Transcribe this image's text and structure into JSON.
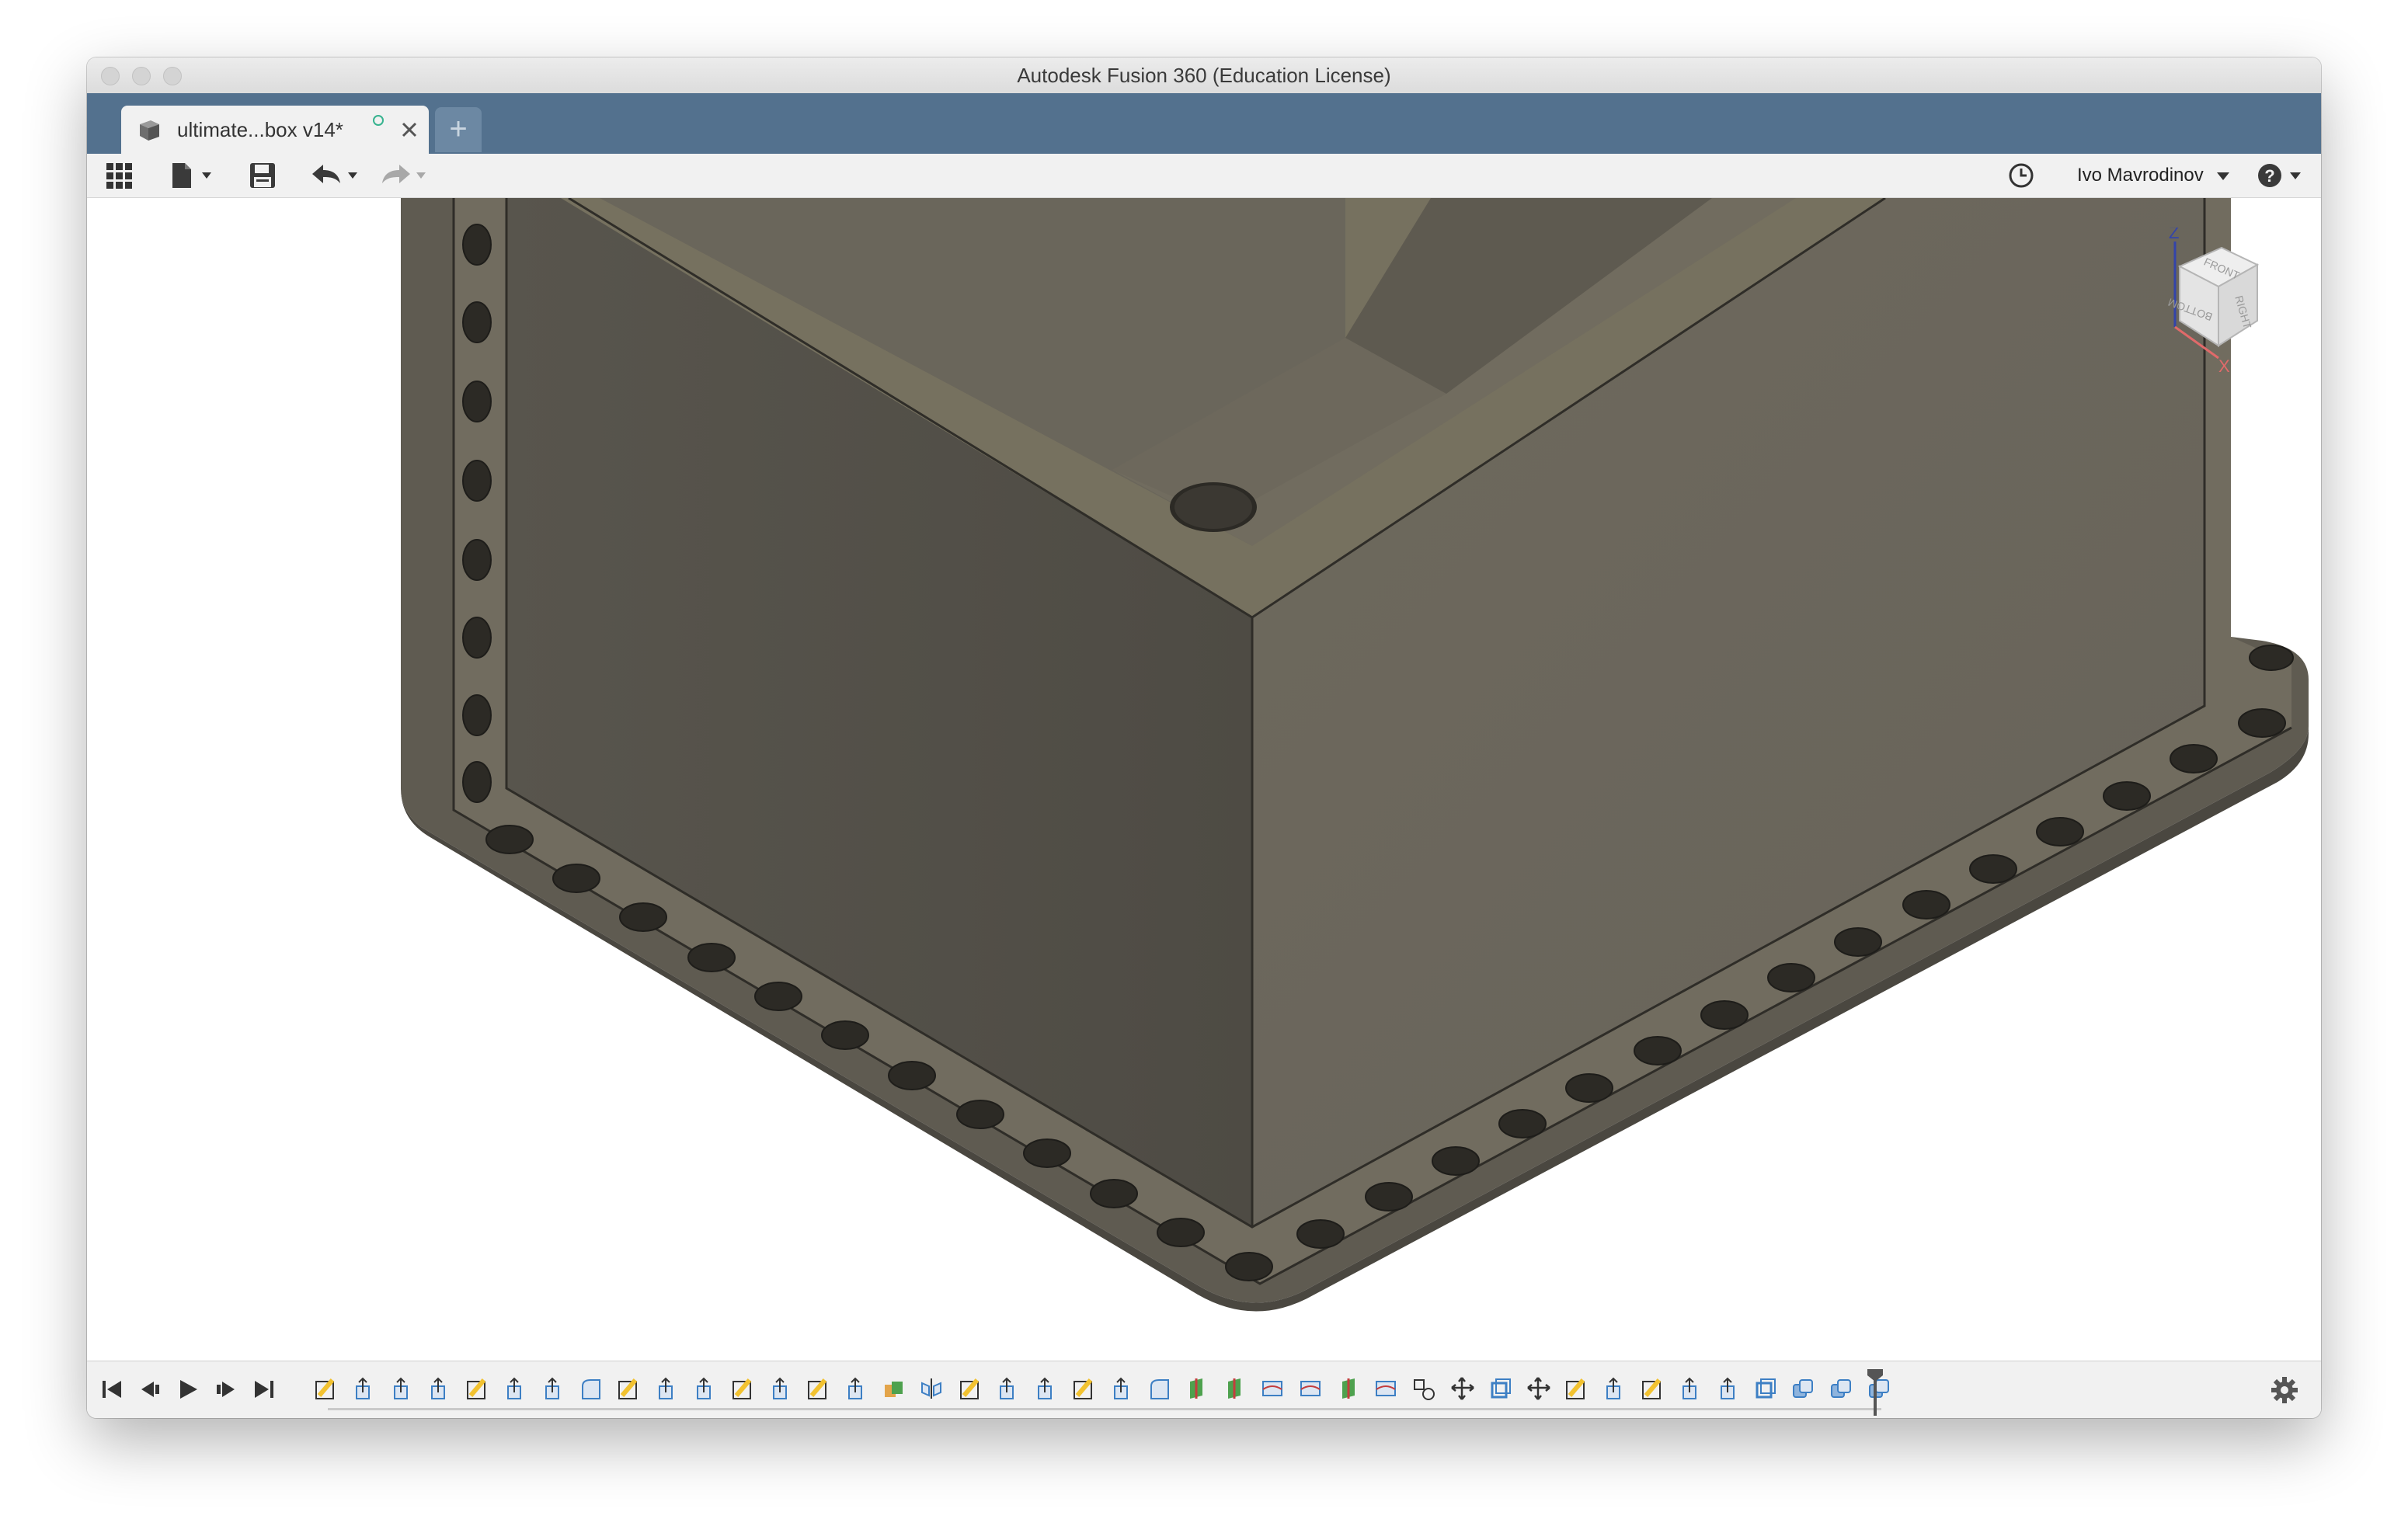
{
  "window": {
    "title": "Autodesk Fusion 360 (Education License)"
  },
  "tabs": [
    {
      "label": "ultimate...box v14*",
      "icon": "component-icon",
      "active": true,
      "status": "saved-indicator",
      "close_icon": "close-icon"
    }
  ],
  "new_tab_label": "+",
  "toolbar": {
    "left_icons": [
      "apps-grid-icon",
      "file-menu-icon",
      "save-icon",
      "undo-icon",
      "redo-icon"
    ],
    "job_status_icon": "clock-icon",
    "user_name": "Ivo Mavrodinov",
    "help_icon": "help-icon"
  },
  "viewcube": {
    "faces": [
      "FRONT",
      "RIGHT",
      "BOTTOM"
    ],
    "axes": [
      "Z",
      "X"
    ]
  },
  "model": {
    "description_icon": "3d-model-box",
    "body_color": "#6b6659",
    "edge_color": "#2f2d28",
    "hole_count_front": 14,
    "hole_count_right": 15,
    "hole_count_left": 8
  },
  "timeline": {
    "controls": [
      "skip-to-start-icon",
      "step-back-icon",
      "play-icon",
      "step-forward-icon",
      "skip-to-end-icon"
    ],
    "features": [
      "sketch",
      "extrude",
      "extrude",
      "extrude",
      "sketch",
      "extrude",
      "extrude",
      "fillet",
      "sketch",
      "extrude",
      "extrude",
      "sketch",
      "extrude",
      "sketch",
      "extrude",
      "combine",
      "mirror",
      "sketch",
      "extrude",
      "extrude",
      "sketch",
      "extrude",
      "fillet",
      "split-body",
      "split-body",
      "loft",
      "loft",
      "split-body",
      "loft",
      "align",
      "move",
      "shell",
      "move",
      "sketch",
      "extrude",
      "sketch",
      "extrude",
      "extrude",
      "shell",
      "copy",
      "copy",
      "copy"
    ],
    "settings_icon": "gear-icon"
  },
  "colors": {
    "tabstrip": "#53718e",
    "accent_green": "#37b38f",
    "sketch_yellow": "#f2c230",
    "feature_blue": "#3d7fc4"
  }
}
